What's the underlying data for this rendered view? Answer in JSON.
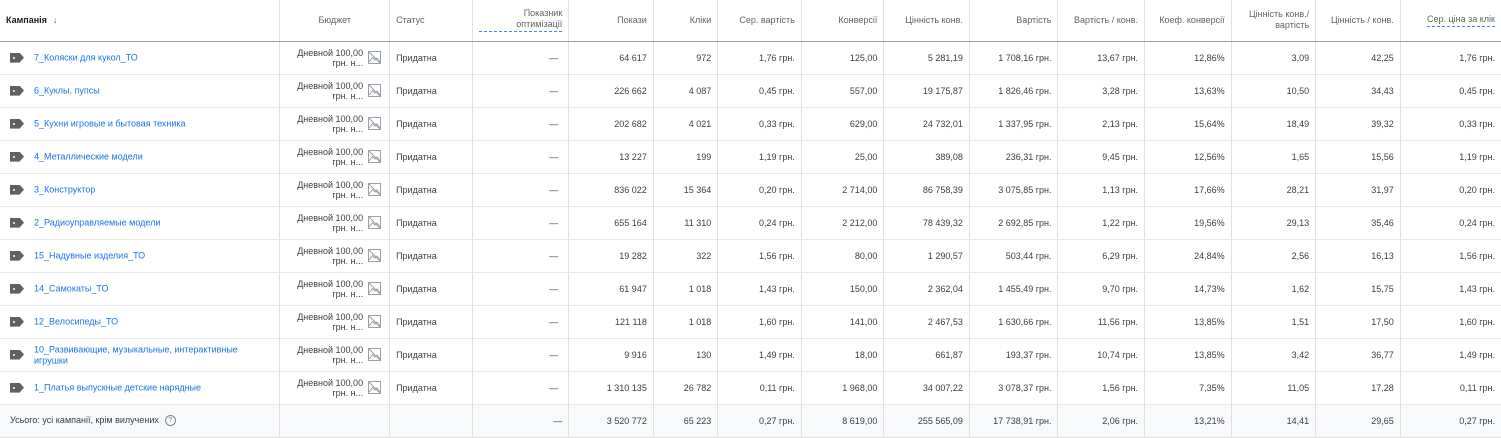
{
  "headers": {
    "campaign": "Кампанія",
    "campaign_sort": "↓",
    "budget": "Бюджет",
    "status": "Статус",
    "optimization": "Показник оптимізації",
    "impressions": "Покази",
    "clicks": "Кліки",
    "avg_cost": "Сер. вартість",
    "conversions": "Конверсії",
    "conv_value": "Цінність конв.",
    "cost": "Вартість",
    "cost_per_conv": "Вартість / конв.",
    "conv_rate": "Коеф. конверсії",
    "value_per_cost": "Цінність конв./ вартість",
    "value_per_conv": "Цінність / конв.",
    "avg_cpc": "Сер. ціна за клік"
  },
  "rows": [
    {
      "name": "7_Коляски для кукол_ТО",
      "budget": "Дневной 100,00 грн. н...",
      "status": "Придатна",
      "opt": "—",
      "impr": "64 617",
      "clicks": "972",
      "avg_cost": "1,76 грн.",
      "conv": "125,00",
      "conv_value": "5 281,19",
      "cost": "1 708,16 грн.",
      "cost_per_conv": "13,67 грн.",
      "conv_rate": "12,86%",
      "value_per_cost": "3,09",
      "value_per_conv": "42,25",
      "avg_cpc": "1,76 грн."
    },
    {
      "name": "6_Куклы, пупсы",
      "budget": "Дневной 100,00 грн. н...",
      "status": "Придатна",
      "opt": "—",
      "impr": "226 662",
      "clicks": "4 087",
      "avg_cost": "0,45 грн.",
      "conv": "557,00",
      "conv_value": "19 175,87",
      "cost": "1 826,46 грн.",
      "cost_per_conv": "3,28 грн.",
      "conv_rate": "13,63%",
      "value_per_cost": "10,50",
      "value_per_conv": "34,43",
      "avg_cpc": "0,45 грн."
    },
    {
      "name": "5_Кухни игровые и бытовая техника",
      "budget": "Дневной 100,00 грн. н...",
      "status": "Придатна",
      "opt": "—",
      "impr": "202 682",
      "clicks": "4 021",
      "avg_cost": "0,33 грн.",
      "conv": "629,00",
      "conv_value": "24 732,01",
      "cost": "1 337,95 грн.",
      "cost_per_conv": "2,13 грн.",
      "conv_rate": "15,64%",
      "value_per_cost": "18,49",
      "value_per_conv": "39,32",
      "avg_cpc": "0,33 грн."
    },
    {
      "name": "4_Металлические модели",
      "budget": "Дневной 100,00 грн. н...",
      "status": "Придатна",
      "opt": "—",
      "impr": "13 227",
      "clicks": "199",
      "avg_cost": "1,19 грн.",
      "conv": "25,00",
      "conv_value": "389,08",
      "cost": "236,31 грн.",
      "cost_per_conv": "9,45 грн.",
      "conv_rate": "12,56%",
      "value_per_cost": "1,65",
      "value_per_conv": "15,56",
      "avg_cpc": "1,19 грн."
    },
    {
      "name": "3_Конструктор",
      "budget": "Дневной 100,00 грн. н...",
      "status": "Придатна",
      "opt": "—",
      "impr": "836 022",
      "clicks": "15 364",
      "avg_cost": "0,20 грн.",
      "conv": "2 714,00",
      "conv_value": "86 758,39",
      "cost": "3 075,85 грн.",
      "cost_per_conv": "1,13 грн.",
      "conv_rate": "17,66%",
      "value_per_cost": "28,21",
      "value_per_conv": "31,97",
      "avg_cpc": "0,20 грн."
    },
    {
      "name": "2_Радиоуправляемые модели",
      "budget": "Дневной 100,00 грн. н...",
      "status": "Придатна",
      "opt": "—",
      "impr": "655 164",
      "clicks": "11 310",
      "avg_cost": "0,24 грн.",
      "conv": "2 212,00",
      "conv_value": "78 439,32",
      "cost": "2 692,85 грн.",
      "cost_per_conv": "1,22 грн.",
      "conv_rate": "19,56%",
      "value_per_cost": "29,13",
      "value_per_conv": "35,46",
      "avg_cpc": "0,24 грн."
    },
    {
      "name": "15_Надувные изделия_ТО",
      "budget": "Дневной 100,00 грн. н...",
      "status": "Придатна",
      "opt": "—",
      "impr": "19 282",
      "clicks": "322",
      "avg_cost": "1,56 грн.",
      "conv": "80,00",
      "conv_value": "1 290,57",
      "cost": "503,44 грн.",
      "cost_per_conv": "6,29 грн.",
      "conv_rate": "24,84%",
      "value_per_cost": "2,56",
      "value_per_conv": "16,13",
      "avg_cpc": "1,56 грн."
    },
    {
      "name": "14_Самокаты_ТО",
      "budget": "Дневной 100,00 грн. н...",
      "status": "Придатна",
      "opt": "—",
      "impr": "61 947",
      "clicks": "1 018",
      "avg_cost": "1,43 грн.",
      "conv": "150,00",
      "conv_value": "2 362,04",
      "cost": "1 455,49 грн.",
      "cost_per_conv": "9,70 грн.",
      "conv_rate": "14,73%",
      "value_per_cost": "1,62",
      "value_per_conv": "15,75",
      "avg_cpc": "1,43 грн."
    },
    {
      "name": "12_Велосипеды_ТО",
      "budget": "Дневной 100,00 грн. н...",
      "status": "Придатна",
      "opt": "—",
      "impr": "121 118",
      "clicks": "1 018",
      "avg_cost": "1,60 грн.",
      "conv": "141,00",
      "conv_value": "2 467,53",
      "cost": "1 630,66 грн.",
      "cost_per_conv": "11,56 грн.",
      "conv_rate": "13,85%",
      "value_per_cost": "1,51",
      "value_per_conv": "17,50",
      "avg_cpc": "1,60 грн."
    },
    {
      "name": "10_Развивающие, музыкальные, интерактивные игрушки",
      "budget": "Дневной 100,00 грн. н...",
      "status": "Придатна",
      "opt": "—",
      "impr": "9 916",
      "clicks": "130",
      "avg_cost": "1,49 грн.",
      "conv": "18,00",
      "conv_value": "661,87",
      "cost": "193,37 грн.",
      "cost_per_conv": "10,74 грн.",
      "conv_rate": "13,85%",
      "value_per_cost": "3,42",
      "value_per_conv": "36,77",
      "avg_cpc": "1,49 грн."
    },
    {
      "name": "1_Платья выпускные детские нарядные",
      "budget": "Дневной 100,00 грн. н...",
      "status": "Придатна",
      "opt": "—",
      "impr": "1 310 135",
      "clicks": "26 782",
      "avg_cost": "0,11 грн.",
      "conv": "1 968,00",
      "conv_value": "34 007,22",
      "cost": "3 078,37 грн.",
      "cost_per_conv": "1,56 грн.",
      "conv_rate": "7,35%",
      "value_per_cost": "11,05",
      "value_per_conv": "17,28",
      "avg_cpc": "0,11 грн."
    }
  ],
  "total": {
    "label": "Усього: усі кампанії, крім вилучених",
    "help": "?",
    "opt": "—",
    "impr": "3 520 772",
    "clicks": "65 223",
    "avg_cost": "0,27 грн.",
    "conv": "8 619,00",
    "conv_value": "255 565,09",
    "cost": "17 738,91 грн.",
    "cost_per_conv": "2,06 грн.",
    "conv_rate": "13,21%",
    "value_per_cost": "14,41",
    "value_per_conv": "29,65",
    "avg_cpc": "0,27 грн."
  },
  "icons": {
    "campaign": "campaign-tag-icon",
    "budget_image": "image-placeholder-icon",
    "sort": "arrow-down-icon",
    "help": "help-circle-icon"
  }
}
